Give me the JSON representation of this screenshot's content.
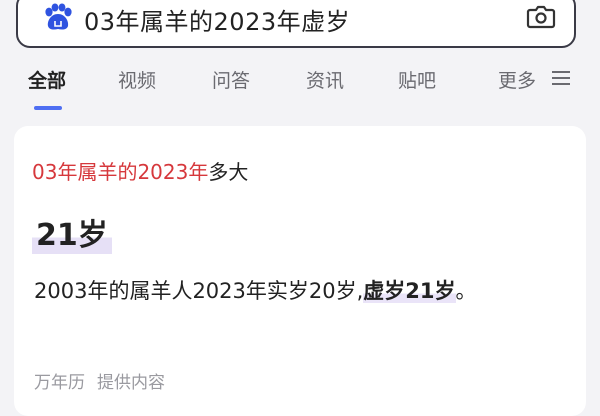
{
  "search": {
    "query": "03年属羊的2023年虚岁"
  },
  "icons": {
    "logo": "baidu-paw-icon",
    "camera": "camera-icon",
    "more": "menu-lines-icon"
  },
  "colors": {
    "accent": "#4e6ef2",
    "highlight_red": "#d6383c",
    "mark_purple": "#e6e0f6"
  },
  "tabs": [
    {
      "label": "全部",
      "active": true
    },
    {
      "label": "视频"
    },
    {
      "label": "问答"
    },
    {
      "label": "资讯"
    },
    {
      "label": "贴吧"
    },
    {
      "label": "更多"
    }
  ],
  "result": {
    "title_highlight": "03年属羊的2023年",
    "title_rest": "多大",
    "answer": "21岁",
    "detail_pre": "2003年的属羊人2023年实岁20岁,",
    "detail_emph": "虚岁21岁",
    "detail_end": "。",
    "source_name": "万年历",
    "source_suffix": "提供内容"
  }
}
